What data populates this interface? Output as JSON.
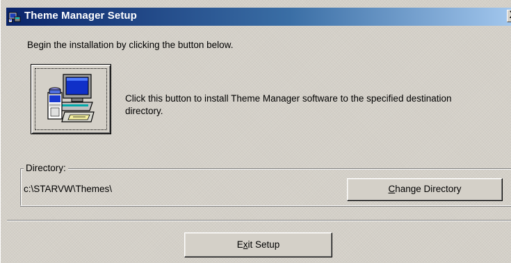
{
  "window": {
    "title": "Theme Manager Setup",
    "close_label": "X"
  },
  "intro": {
    "text": "Begin the installation by clicking the button below."
  },
  "install": {
    "icon": "setup-computer-icon",
    "description": "Click this button to install Theme Manager software to the specified destination directory."
  },
  "directory": {
    "group_label": "Directory:",
    "path": "c:\\STARVW\\Themes\\",
    "change_button": {
      "label_before": "",
      "mnemonic": "C",
      "label_after": "hange Directory"
    }
  },
  "footer": {
    "exit_button": {
      "label_before": "E",
      "mnemonic": "x",
      "label_after": "it Setup"
    }
  },
  "colors": {
    "face": "#d4d0c8",
    "titlebar_start": "#0a246a",
    "titlebar_end": "#a6caf0"
  }
}
